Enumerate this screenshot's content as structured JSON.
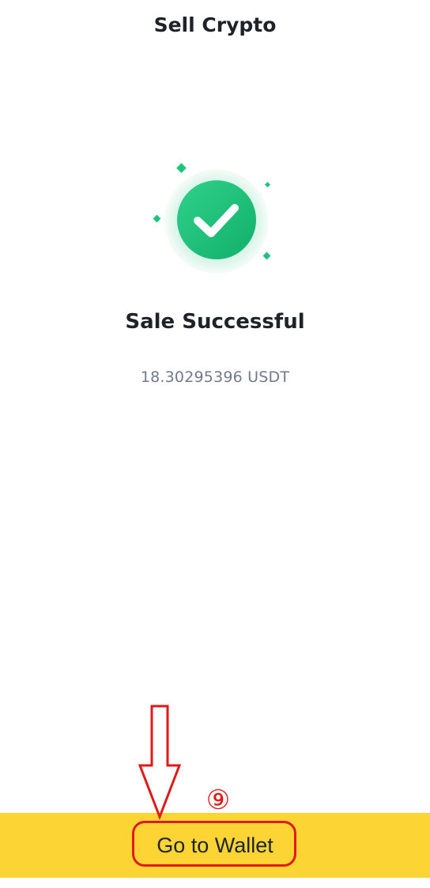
{
  "header": {
    "title": "Sell Crypto"
  },
  "result": {
    "icon": "success-check-icon",
    "title": "Sale Successful",
    "amount": "18.30295396 USDT"
  },
  "footer": {
    "button_label": "Go to Wallet",
    "background_color": "#fcd535"
  },
  "annotation": {
    "step_number": "⑨",
    "color": "#e01919"
  },
  "colors": {
    "success_green": "#1ec47b",
    "text_primary": "#1e2329",
    "text_secondary": "#707a8a"
  }
}
